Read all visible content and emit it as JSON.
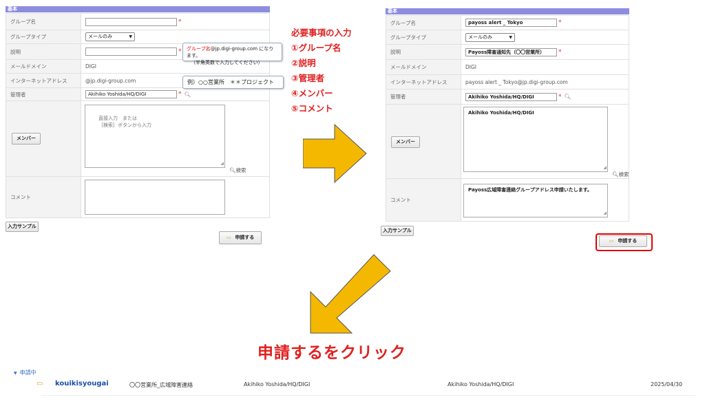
{
  "section_title": "基本",
  "labels": {
    "group_name": "グループ名",
    "group_type": "グループタイプ",
    "description": "説明",
    "mail_domain": "メールドメイン",
    "internet_address": "インターネットアドレス",
    "manager": "管理者",
    "members": "メンバー",
    "comment": "コメント"
  },
  "before": {
    "group_name": "",
    "group_type": "メールのみ",
    "description": "",
    "mail_domain": "DIGI",
    "internet_address": "@jp.digi-group.com",
    "manager": "Akihiko Yoshida/HQ/DIGI",
    "members_placeholder_1": "直接入力　または",
    "members_placeholder_2": "［検索］ボタンから入力",
    "comment": ""
  },
  "tooltip_group": {
    "prefix": "グループ名",
    "suffix": "@jp.digi-group.com になります。",
    "line2": "（半角英数で入力してください）"
  },
  "tooltip_desc": "例）○○営業所　＊＊プロジェクト",
  "after": {
    "group_name": "payoss alert _ Tokyo",
    "group_type": "メールのみ",
    "description": "Payoss障害通知先（〇〇営業所）",
    "mail_domain": "DIGI",
    "internet_address": "payoss alert _ Tokyo@jp.digi-group.com",
    "manager": "Akihiko Yoshida/HQ/DIGI",
    "members_value": "Akihiko Yoshida/HQ/DIGI",
    "comment": "Payoss広域障害連絡グループアドレス申請いたします。"
  },
  "buttons": {
    "members": "メンバー",
    "search": "検索",
    "input_sample": "入力サンプル",
    "apply": "申請する"
  },
  "steps": {
    "title": "必要事項の入力",
    "s1": "①グループ名",
    "s2": "②説明",
    "s3": "③管理者",
    "s4": "④メンバー",
    "s5": "⑤コメント"
  },
  "instruction": "申請するをクリック",
  "list": {
    "section": "申請中",
    "row": {
      "name": "kouikisyougai",
      "description": "〇〇営業所_広域障害連絡",
      "applicant": "Akihiko Yoshida/HQ/DIGI",
      "manager": "Akihiko Yoshida/HQ/DIGI",
      "date": "2025/04/30"
    }
  },
  "colors": {
    "header": "#8d8de0",
    "accent_red": "#e02020",
    "arrow": "#f5b800",
    "link": "#3a6fc8"
  }
}
